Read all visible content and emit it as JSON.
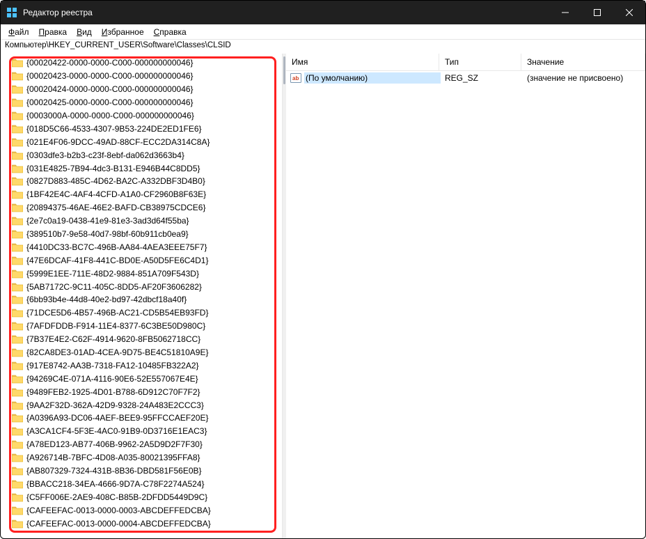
{
  "title": "Редактор реестра",
  "menu": {
    "file": "Файл",
    "edit": "Правка",
    "view": "Вид",
    "favorites": "Избранное",
    "help": "Справка"
  },
  "address": "Компьютер\\HKEY_CURRENT_USER\\Software\\Classes\\CLSID",
  "tree": [
    "{00020422-0000-0000-C000-000000000046}",
    "{00020423-0000-0000-C000-000000000046}",
    "{00020424-0000-0000-C000-000000000046}",
    "{00020425-0000-0000-C000-000000000046}",
    "{0003000A-0000-0000-C000-000000000046}",
    "{018D5C66-4533-4307-9B53-224DE2ED1FE6}",
    "{021E4F06-9DCC-49AD-88CF-ECC2DA314C8A}",
    "{0303dfe3-b2b3-c23f-8ebf-da062d3663b4}",
    "{031E4825-7B94-4dc3-B131-E946B44C8DD5}",
    "{0827D883-485C-4D62-BA2C-A332DBF3D4B0}",
    "{1BF42E4C-4AF4-4CFD-A1A0-CF2960B8F63E}",
    "{20894375-46AE-46E2-BAFD-CB38975CDCE6}",
    "{2e7c0a19-0438-41e9-81e3-3ad3d64f55ba}",
    "{389510b7-9e58-40d7-98bf-60b911cb0ea9}",
    "{4410DC33-BC7C-496B-AA84-4AEA3EEE75F7}",
    "{47E6DCAF-41F8-441C-BD0E-A50D5FE6C4D1}",
    "{5999E1EE-711E-48D2-9884-851A709F543D}",
    "{5AB7172C-9C11-405C-8DD5-AF20F3606282}",
    "{6bb93b4e-44d8-40e2-bd97-42dbcf18a40f}",
    "{71DCE5D6-4B57-496B-AC21-CD5B54EB93FD}",
    "{7AFDFDDB-F914-11E4-8377-6C3BE50D980C}",
    "{7B37E4E2-C62F-4914-9620-8FB5062718CC}",
    "{82CA8DE3-01AD-4CEA-9D75-BE4C51810A9E}",
    "{917E8742-AA3B-7318-FA12-10485FB322A2}",
    "{94269C4E-071A-4116-90E6-52E557067E4E}",
    "{9489FEB2-1925-4D01-B788-6D912C70F7F2}",
    "{9AA2F32D-362A-42D9-9328-24A483E2CCC3}",
    "{A0396A93-DC06-4AEF-BEE9-95FFCCAEF20E}",
    "{A3CA1CF4-5F3E-4AC0-91B9-0D3716E1EAC3}",
    "{A78ED123-AB77-406B-9962-2A5D9D2F7F30}",
    "{A926714B-7BFC-4D08-A035-80021395FFA8}",
    "{AB807329-7324-431B-8B36-DBD581F56E0B}",
    "{BBACC218-34EA-4666-9D7A-C78F2274A524}",
    "{C5FF006E-2AE9-408C-B85B-2DFDD5449D9C}",
    "{CAFEEFAC-0013-0000-0003-ABCDEFFEDCBA}",
    "{CAFEEFAC-0013-0000-0004-ABCDEFFEDCBA}"
  ],
  "columns": {
    "name": "Имя",
    "type": "Тип",
    "value": "Значение"
  },
  "values": [
    {
      "name": "(По умолчанию)",
      "type": "REG_SZ",
      "data": "(значение не присвоено)"
    }
  ]
}
